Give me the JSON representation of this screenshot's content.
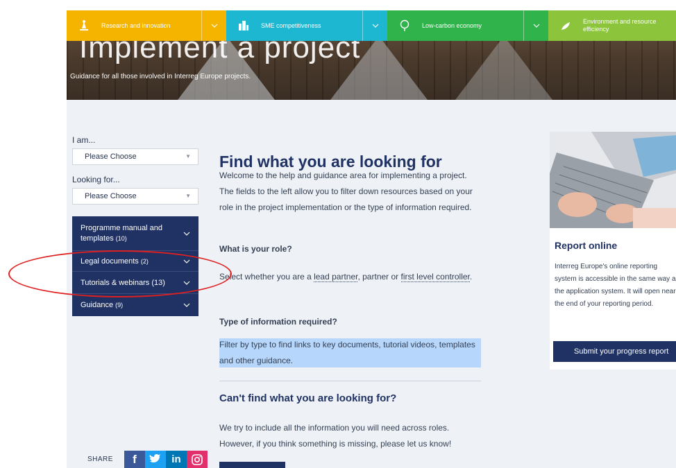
{
  "hero": {
    "title": "Implement a project",
    "subtitle": "Guidance for all those involved in Interreg Europe projects."
  },
  "categories": [
    {
      "label": "Research and innovation",
      "icon": "research-icon",
      "color": "#f5b400"
    },
    {
      "label": "SME competitiveness",
      "icon": "sme-icon",
      "color": "#1db7d1"
    },
    {
      "label": "Low-carbon economy",
      "icon": "low-carbon-icon",
      "color": "#2fb34a"
    },
    {
      "label": "Environment and resource efficiency",
      "icon": "environment-icon",
      "color": "#8cc43c"
    }
  ],
  "filters": {
    "iam_label": "I am...",
    "iam_value": "Please Choose",
    "looking_label": "Looking for...",
    "looking_value": "Please Choose"
  },
  "accordion": [
    {
      "label": "Programme manual and templates",
      "count": "(10)"
    },
    {
      "label": "Legal documents",
      "count": "(2)"
    },
    {
      "label": "Tutorials & webinars",
      "count": "(13)"
    },
    {
      "label": "Guidance",
      "count": "(9)"
    }
  ],
  "main": {
    "heading": "Find what you are looking for",
    "intro": "Welcome to the help and guidance area for implementing a project. The fields to the left allow you to filter down resources based on your role in the project implementation or the type of information required.",
    "role_heading": "What is your role?",
    "role_text_1": "Select whether you are a ",
    "role_link_1": "lead partner",
    "role_text_2": ", partner or ",
    "role_link_2": "first level controller",
    "role_text_3": ".",
    "type_heading": "Type of information required?",
    "type_text": "Filter by type to find links to key documents, tutorial videos, templates and other guidance.",
    "cant_find_heading": "Can't find what you are looking for?",
    "cant_find_text": "We try to include all the information you will need across roles. However, if you think something is missing, please let us know!"
  },
  "share": {
    "label": "SHARE",
    "icons": [
      {
        "name": "facebook-icon",
        "glyph": "f",
        "color": "#3b5998"
      },
      {
        "name": "twitter-icon",
        "glyph": "t",
        "color": "#1da1f2"
      },
      {
        "name": "linkedin-icon",
        "glyph": "in",
        "color": "#0077b5"
      },
      {
        "name": "instagram-icon",
        "glyph": "◎",
        "color": "#e1306c"
      }
    ]
  },
  "card": {
    "title": "Report online",
    "text": "Interreg Europe's online reporting system is accessible in the same way as the application system. It will open near the end of your reporting period.",
    "button": "Submit your progress report"
  }
}
